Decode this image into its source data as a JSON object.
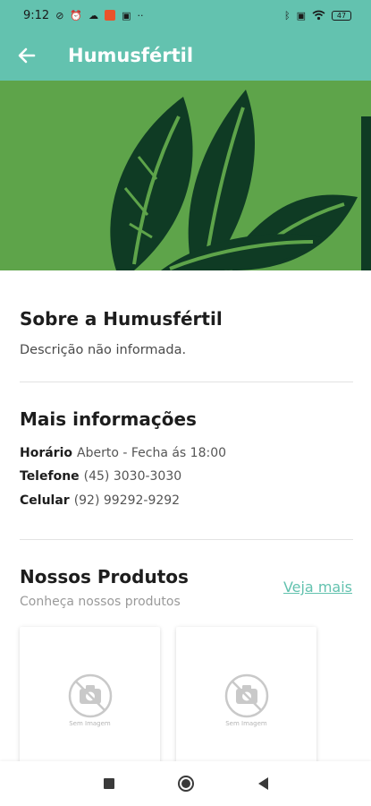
{
  "status_bar": {
    "time": "9:12",
    "battery": "47"
  },
  "app_bar": {
    "title": "Humusfértil"
  },
  "about": {
    "title": "Sobre a Humusfértil",
    "description": "Descrição não informada."
  },
  "more_info": {
    "title": "Mais informações",
    "rows": [
      {
        "label": "Horário",
        "value": "Aberto - Fecha ás 18:00"
      },
      {
        "label": "Telefone",
        "value": "(45) 3030-3030"
      },
      {
        "label": "Celular",
        "value": "(92) 99292-9292"
      }
    ]
  },
  "products": {
    "title": "Nossos Produtos",
    "subtitle": "Conheça nossos produtos",
    "see_more": "Veja mais",
    "cards": [
      {
        "placeholder": "Sem Imagem"
      },
      {
        "placeholder": "Sem Imagem"
      }
    ]
  },
  "colors": {
    "primary": "#63c2af",
    "banner": "#5ea44a",
    "logo_dark": "#0f3b24"
  },
  "icons": [
    "back-arrow-icon",
    "no-image-icon",
    "nav-recents-icon",
    "nav-home-icon",
    "nav-back-icon"
  ]
}
